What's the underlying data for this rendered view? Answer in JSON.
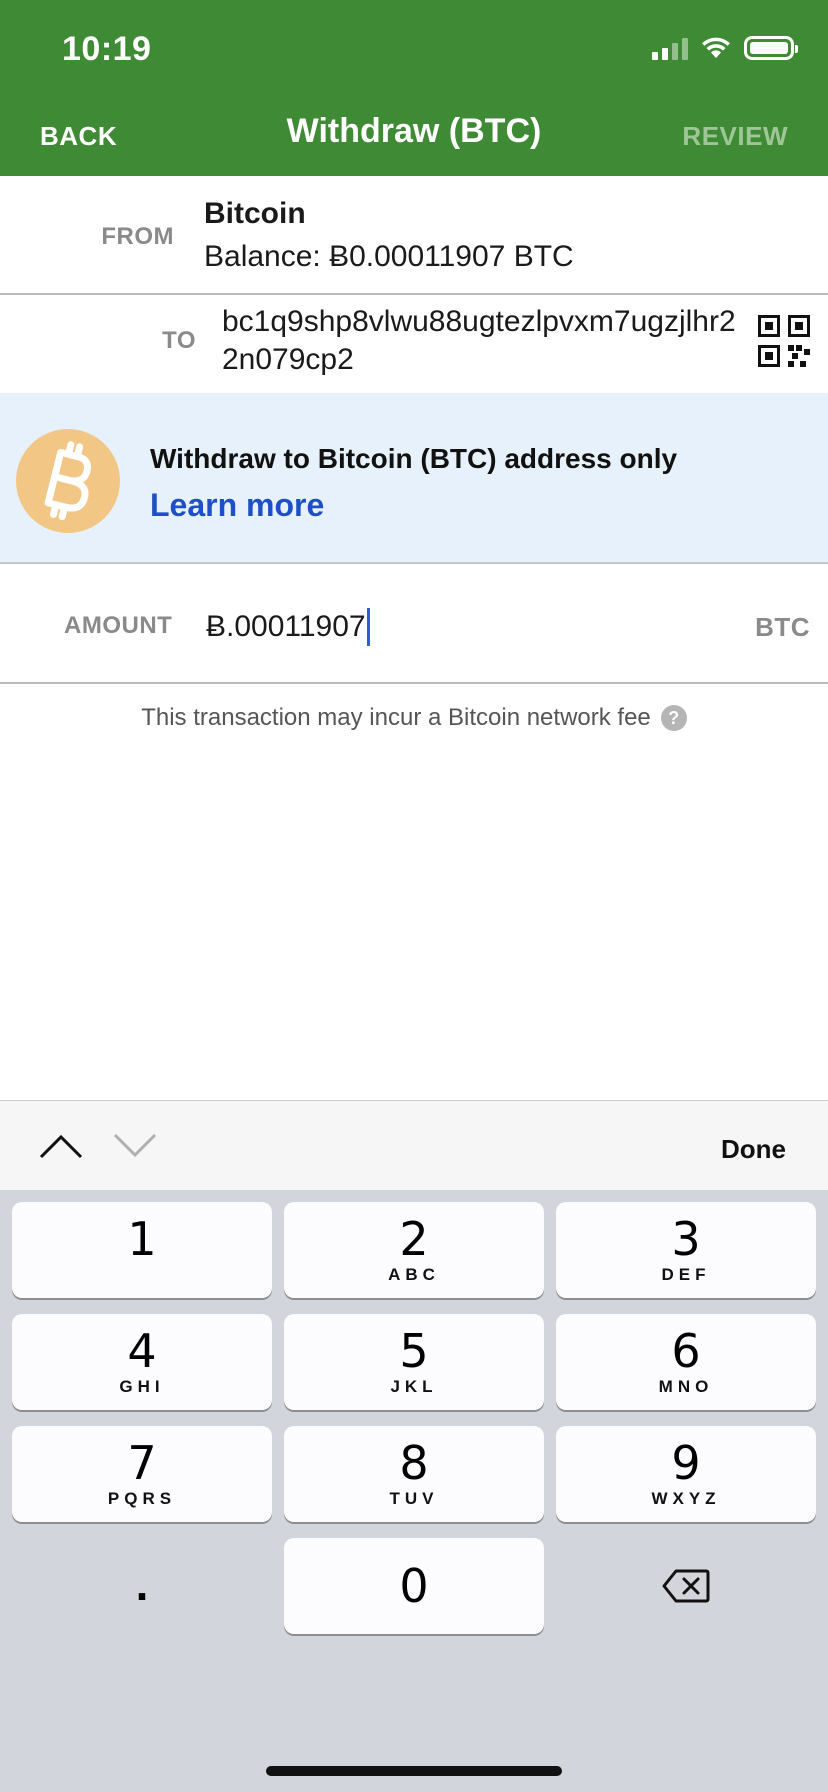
{
  "status_bar": {
    "time": "10:19"
  },
  "nav": {
    "back": "BACK",
    "title": "Withdraw (BTC)",
    "review": "REVIEW"
  },
  "from": {
    "label": "FROM",
    "name": "Bitcoin",
    "balance": "Balance: Ƀ0.00011907 BTC"
  },
  "to": {
    "label": "TO",
    "address": "bc1q9shp8vlwu88ugtezlpvxm7ugzjlhr22n079cp2"
  },
  "banner": {
    "message": "Withdraw to Bitcoin (BTC) address only",
    "link": "Learn more"
  },
  "amount": {
    "label": "AMOUNT",
    "value": "Ƀ.00011907",
    "unit": "BTC"
  },
  "fee_note": "This transaction may incur a Bitcoin network fee",
  "accessory": {
    "done": "Done"
  },
  "keypad": {
    "keys": [
      {
        "num": "1",
        "letters": ""
      },
      {
        "num": "2",
        "letters": "ABC"
      },
      {
        "num": "3",
        "letters": "DEF"
      },
      {
        "num": "4",
        "letters": "GHI"
      },
      {
        "num": "5",
        "letters": "JKL"
      },
      {
        "num": "6",
        "letters": "MNO"
      },
      {
        "num": "7",
        "letters": "PQRS"
      },
      {
        "num": "8",
        "letters": "TUV"
      },
      {
        "num": "9",
        "letters": "WXYZ"
      },
      {
        "num": "0",
        "letters": ""
      }
    ],
    "decimal": ".",
    "delete_icon": "backspace-icon"
  },
  "colors": {
    "header": "#3f8a34",
    "link": "#1e4fc7",
    "banner_bg": "#e6f1fb",
    "btc_logo": "#f2c685"
  }
}
